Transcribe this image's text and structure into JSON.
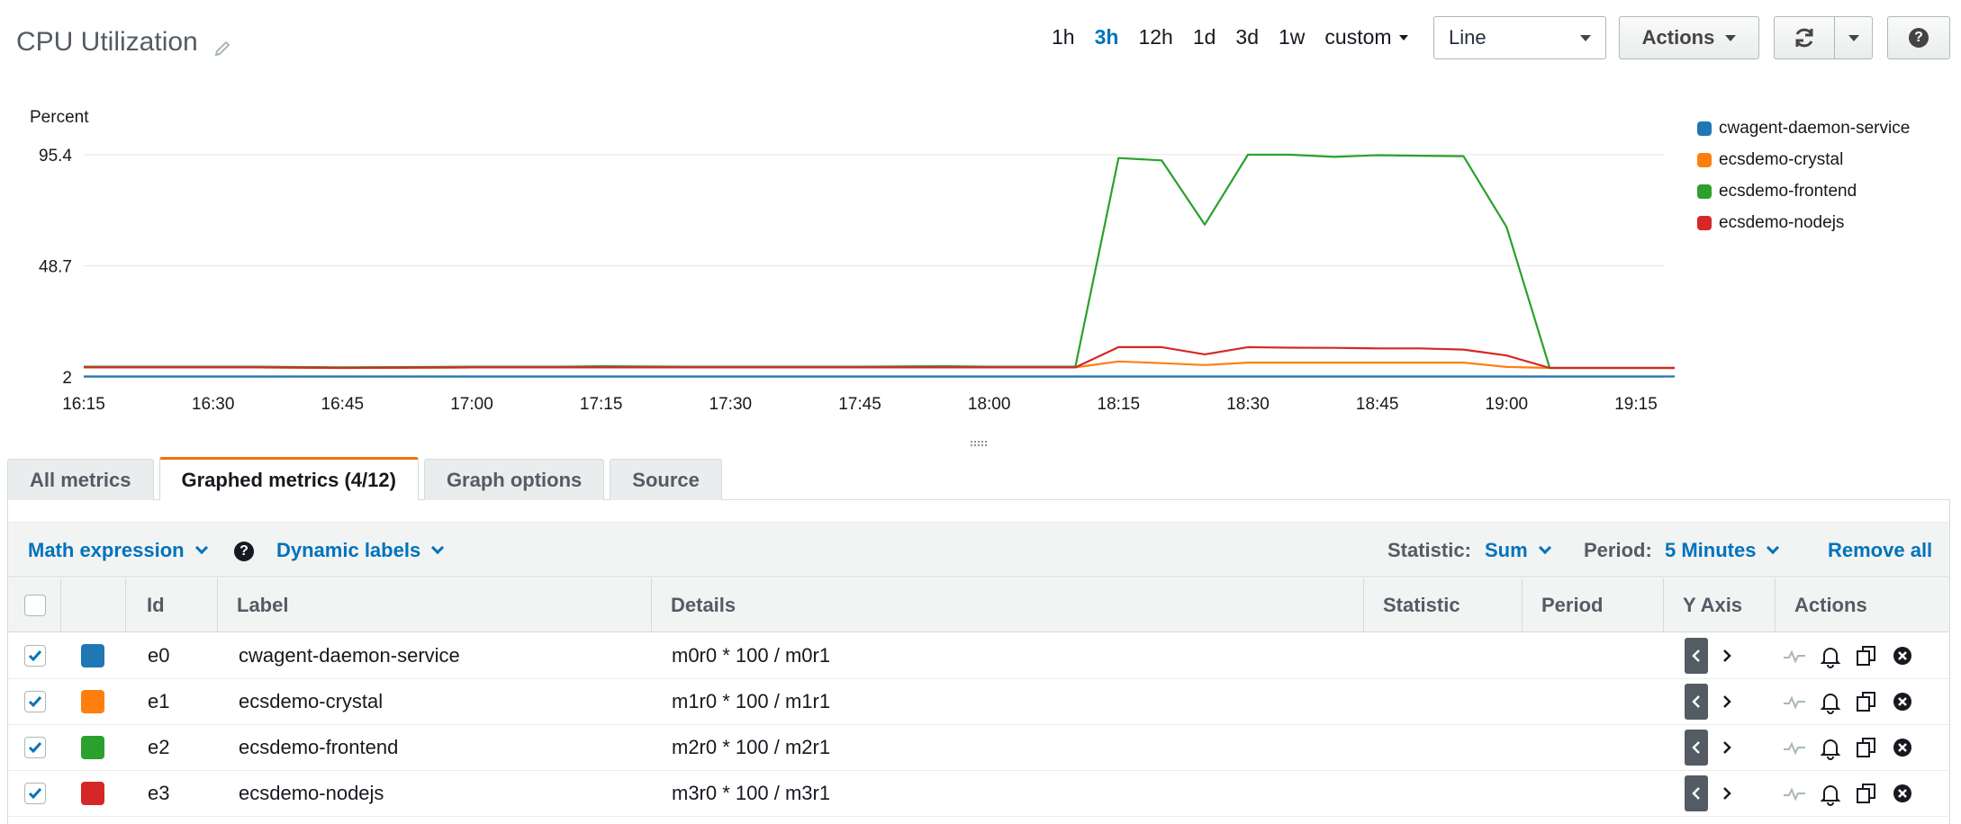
{
  "header": {
    "title": "CPU Utilization",
    "time_ranges": [
      "1h",
      "3h",
      "12h",
      "1d",
      "3d",
      "1w"
    ],
    "active_range": "3h",
    "custom_label": "custom",
    "view_select": "Line",
    "actions_label": "Actions",
    "help_label": "?"
  },
  "chart_data": {
    "type": "line",
    "ylabel": "Percent",
    "y_ticks": [
      "95.4",
      "48.7",
      "2"
    ],
    "ylim": [
      2,
      95.4
    ],
    "x_ticks": [
      "16:15",
      "16:30",
      "16:45",
      "17:00",
      "17:15",
      "17:30",
      "17:45",
      "18:00",
      "18:15",
      "18:30",
      "18:45",
      "19:00",
      "19:15"
    ],
    "x_minutes": [
      975,
      990,
      995,
      1005,
      1020,
      1030,
      1035,
      1045,
      1055,
      1065,
      1075,
      1080,
      1090,
      1095,
      1100,
      1105,
      1110,
      1115,
      1120,
      1125,
      1130,
      1135,
      1140,
      1145,
      1150,
      1155,
      1160
    ],
    "legend_position": "right",
    "grid": true,
    "series": [
      {
        "name": "cwagent-daemon-service",
        "color": "#1f77b4",
        "values": [
          2.2,
          2.2,
          2.2,
          2.2,
          2.2,
          2.2,
          2.2,
          2.2,
          2.2,
          2.2,
          2.2,
          2.2,
          2.2,
          2.2,
          2.2,
          2.2,
          2.2,
          2.2,
          2.2,
          2.2,
          2.2,
          2.2,
          2.2,
          2.2,
          2.2,
          2.2,
          2.2
        ]
      },
      {
        "name": "ecsdemo-crystal",
        "color": "#ff7f0e",
        "values": [
          6.0,
          6.0,
          6.0,
          5.8,
          6.0,
          6.0,
          6.0,
          6.0,
          6.0,
          6.0,
          6.2,
          6.0,
          6.0,
          8.5,
          7.8,
          7.0,
          8.0,
          8.0,
          8.0,
          8.0,
          8.0,
          8.0,
          6.2,
          5.8,
          5.8,
          5.8,
          5.8
        ]
      },
      {
        "name": "ecsdemo-frontend",
        "color": "#2ca02c",
        "values": [
          6.3,
          6.3,
          6.3,
          6.0,
          6.3,
          6.3,
          6.5,
          6.3,
          6.3,
          6.3,
          6.5,
          6.3,
          6.3,
          94.0,
          93.0,
          66.0,
          95.4,
          95.4,
          94.5,
          95.2,
          95.0,
          94.8,
          65.0,
          5.8,
          5.8,
          5.8,
          5.8
        ]
      },
      {
        "name": "ecsdemo-nodejs",
        "color": "#d62728",
        "values": [
          6.0,
          6.0,
          6.0,
          5.8,
          6.0,
          6.0,
          6.0,
          6.0,
          6.0,
          6.0,
          6.0,
          6.0,
          6.0,
          14.5,
          14.5,
          11.5,
          14.5,
          14.3,
          14.2,
          14.0,
          14.0,
          13.5,
          11.0,
          5.8,
          5.8,
          5.8,
          5.8
        ]
      }
    ]
  },
  "tabs": [
    "All metrics",
    "Graphed metrics (4/12)",
    "Graph options",
    "Source"
  ],
  "active_tab": "Graphed metrics (4/12)",
  "toolbar": {
    "math_expression": "Math expression",
    "dynamic_labels": "Dynamic labels",
    "statistic_label": "Statistic:",
    "statistic_value": "Sum",
    "period_label": "Period:",
    "period_value": "5 Minutes",
    "remove_all": "Remove all"
  },
  "table": {
    "columns": [
      "Id",
      "Label",
      "Details",
      "Statistic",
      "Period",
      "Y Axis",
      "Actions"
    ],
    "rows": [
      {
        "id": "e0",
        "label": "cwagent-daemon-service",
        "details": "m0r0 * 100 / m0r1",
        "color": "#1f77b4",
        "checked": true
      },
      {
        "id": "e1",
        "label": "ecsdemo-crystal",
        "details": "m1r0 * 100 / m1r1",
        "color": "#ff7f0e",
        "checked": true
      },
      {
        "id": "e2",
        "label": "ecsdemo-frontend",
        "details": "m2r0 * 100 / m2r1",
        "color": "#2ca02c",
        "checked": true
      },
      {
        "id": "e3",
        "label": "ecsdemo-nodejs",
        "details": "m3r0 * 100 / m3r1",
        "color": "#d62728",
        "checked": true
      }
    ]
  }
}
